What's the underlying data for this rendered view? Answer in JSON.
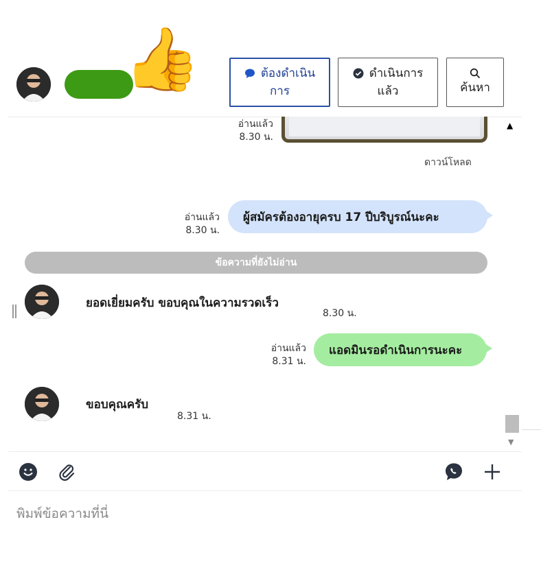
{
  "header": {
    "thumb_emoji": "👍",
    "pill_color": "#3d9a14",
    "buttons": {
      "todo": {
        "line1": "ต้องดำเนิน",
        "line2": "การ",
        "icon": "chat-bubble-icon",
        "color": "#1e3f93"
      },
      "done": {
        "line1": "ดำเนินการ",
        "line2": "แล้ว",
        "icon": "check-circle-icon"
      },
      "search": {
        "line2": "ค้นหา",
        "icon": "search-icon"
      }
    }
  },
  "messages": {
    "image_msg": {
      "read": "อ่านแล้ว",
      "time": "8.30 น.",
      "download": "ดาวน์โหลด"
    },
    "out1": {
      "read": "อ่านแล้ว",
      "time": "8.30 น.",
      "text": "ผู้สมัครต้องอายุครบ  17  ปีบริบูรณ์นะคะ",
      "color": "#d3e3fb"
    },
    "unread_divider": "ข้อความที่ยังไม่อ่าน",
    "in1": {
      "text": "ยอดเยี่ยมครับ ขอบคุณในความรวดเร็ว",
      "time": "8.30 น."
    },
    "out2": {
      "read": "อ่านแล้ว",
      "time": "8.31 น.",
      "text": "แอดมินรอดำเนินการนะคะ",
      "color": "#a4eda0"
    },
    "in2": {
      "text": "ขอบคุณครับ",
      "time": "8.31 น."
    }
  },
  "composer": {
    "placeholder": "พิมพ์ข้อความที่นี่",
    "tools": [
      "emoji-icon",
      "paperclip-icon",
      "call-icon",
      "plus-icon"
    ]
  }
}
